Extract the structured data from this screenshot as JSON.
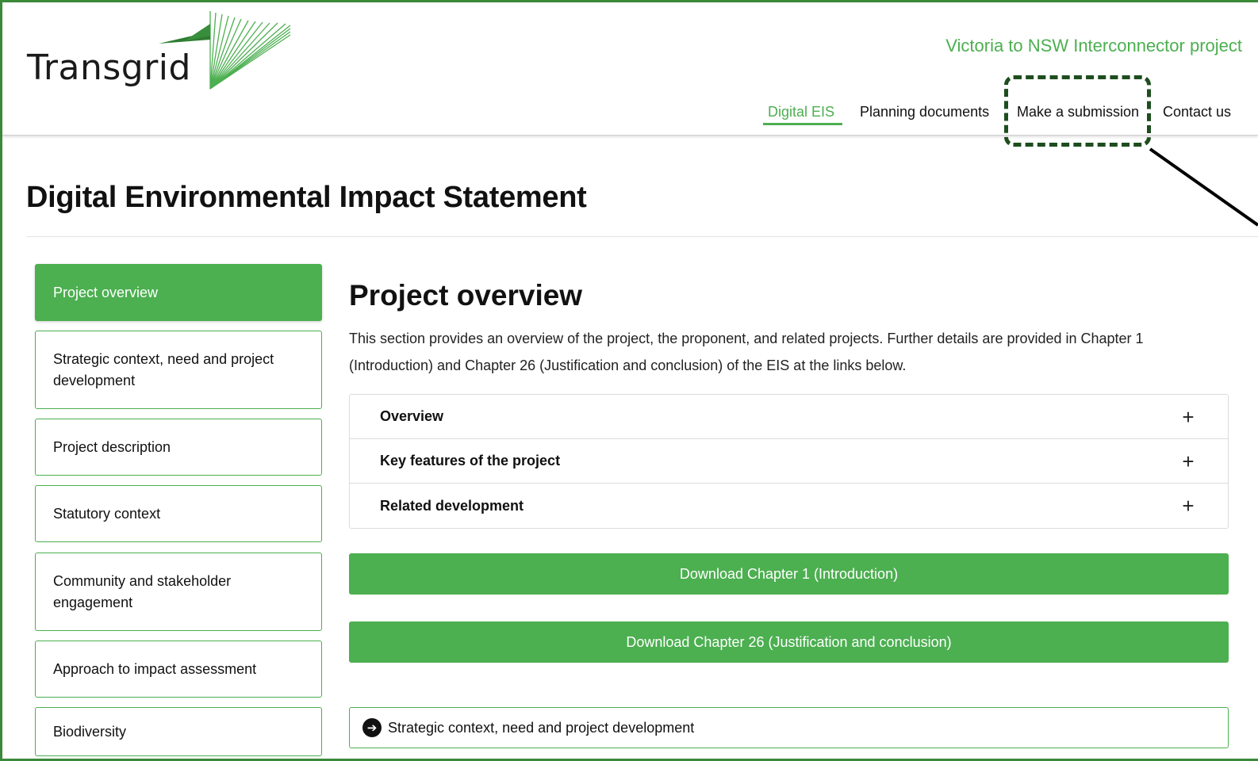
{
  "brand": {
    "logo_text": "Transgrid",
    "project_name": "Victoria to NSW Interconnector project",
    "accent": "#4caf50"
  },
  "nav": {
    "items": [
      {
        "label": "Digital EIS",
        "active": true
      },
      {
        "label": "Planning documents"
      },
      {
        "label": "Make a submission"
      },
      {
        "label": "Contact us"
      }
    ]
  },
  "page": {
    "title": "Digital Environmental Impact Statement"
  },
  "sidebar": {
    "items": [
      {
        "label": "Project overview",
        "active": true
      },
      {
        "label": "Strategic context, need and project development"
      },
      {
        "label": "Project description"
      },
      {
        "label": "Statutory context"
      },
      {
        "label": "Community and stakeholder engagement"
      },
      {
        "label": "Approach to impact assessment"
      },
      {
        "label": "Biodiversity"
      }
    ]
  },
  "main": {
    "title": "Project overview",
    "description": "This section provides an overview of the project, the proponent, and related projects. Further details are provided in Chapter 1 (Introduction) and Chapter 26 (Justification and conclusion) of the EIS at the links below.",
    "accordion": [
      {
        "label": "Overview",
        "icon": "plus-icon"
      },
      {
        "label": "Key features of the project",
        "icon": "plus-icon"
      },
      {
        "label": "Related development",
        "icon": "plus-icon"
      }
    ],
    "downloads": [
      {
        "label": "Download Chapter 1 (Introduction)"
      },
      {
        "label": "Download Chapter 26 (Justification and conclusion)"
      }
    ],
    "next_link": {
      "label": "Strategic context, need and project development",
      "icon": "arrow-right-circle-icon"
    }
  }
}
